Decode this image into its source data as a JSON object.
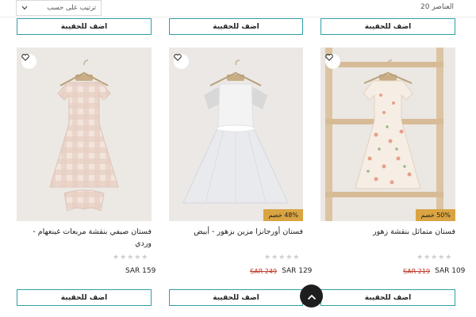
{
  "header": {
    "result_count": "20 العناصر",
    "sort_label": "ترتيب على حسب"
  },
  "add_to_bag": "اضف للحقيبة",
  "products": [
    {
      "title": "فستان متماثل بنقشة زهور",
      "discount": "50% خصم",
      "old_price": "SAR 219",
      "price": "SAR 109",
      "rating": 0
    },
    {
      "title": "فستان أورجانزا مزين بزهور - أبيض",
      "discount": "48% خصم",
      "old_price": "SAR 249",
      "price": "SAR 129",
      "rating": 0
    },
    {
      "title": "فستان صيفي بنقشة مربعات غينغهام - وردي",
      "discount": "",
      "old_price": "",
      "price": "SAR 159",
      "rating": 0
    }
  ],
  "icons": {
    "wishlist": "heart-icon",
    "sort": "chevron-down-icon",
    "scroll_top": "chevron-up-icon",
    "rating": "star-icon"
  },
  "colors": {
    "button_border": "#2f9fa6",
    "discount_badge": "#d9a441",
    "old_price": "#c0392b"
  }
}
